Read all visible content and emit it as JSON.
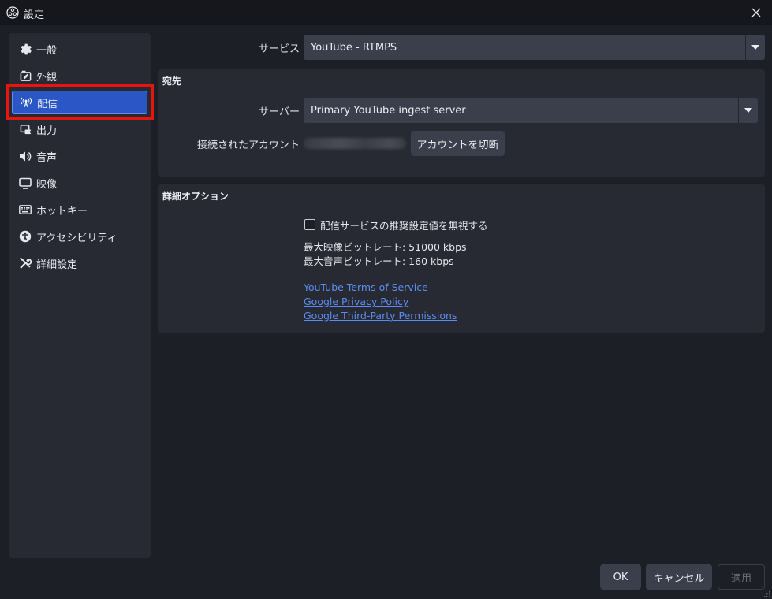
{
  "window": {
    "title": "設定",
    "app_icon": "obs-logo-icon",
    "close_icon": "close-icon"
  },
  "sidebar": {
    "items": [
      {
        "label": "一般",
        "icon": "gear-icon"
      },
      {
        "label": "外観",
        "icon": "appearance-icon"
      },
      {
        "label": "配信",
        "icon": "broadcast-icon",
        "active": true
      },
      {
        "label": "出力",
        "icon": "output-icon"
      },
      {
        "label": "音声",
        "icon": "speaker-icon"
      },
      {
        "label": "映像",
        "icon": "monitor-icon"
      },
      {
        "label": "ホットキー",
        "icon": "keyboard-icon"
      },
      {
        "label": "アクセシビリティ",
        "icon": "accessibility-icon"
      },
      {
        "label": "詳細設定",
        "icon": "wrench-icon"
      }
    ]
  },
  "service": {
    "label": "サービス",
    "value": "YouTube - RTMPS"
  },
  "destination": {
    "title": "宛先",
    "server_label": "サーバー",
    "server_value": "Primary YouTube ingest server",
    "account_label": "接続されたアカウント",
    "disconnect_button": "アカウントを切断"
  },
  "advanced": {
    "title": "詳細オプション",
    "ignore_checkbox_label": "配信サービスの推奨設定値を無視する",
    "ignore_checked": false,
    "max_video_bitrate": "最大映像ビットレート: 51000 kbps",
    "max_audio_bitrate": "最大音声ビットレート: 160 kbps",
    "links": [
      "YouTube Terms of Service",
      "Google Privacy Policy",
      "Google Third-Party Permissions"
    ]
  },
  "footer": {
    "ok": "OK",
    "cancel": "キャンセル",
    "apply": "適用"
  },
  "colors": {
    "accent": "#2b56c6",
    "link": "#5b8cf0",
    "highlight": "#e8150c",
    "background": "#1d1f26",
    "panel": "#272a33"
  }
}
